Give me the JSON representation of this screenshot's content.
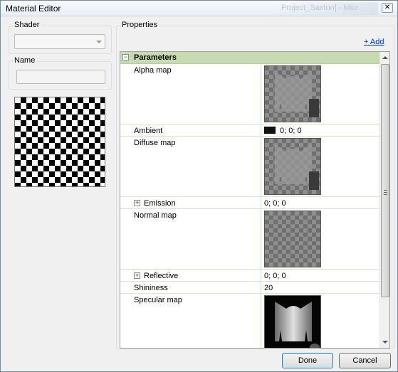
{
  "window": {
    "title": "Material Editor",
    "background_title": "Project_Saxton] - Micr"
  },
  "shader": {
    "label": "Shader",
    "value": ""
  },
  "name": {
    "label": "Name",
    "value": ""
  },
  "properties": {
    "label": "Properties",
    "add_link": "+ Add",
    "category": "Parameters",
    "rows": {
      "alpha_map": {
        "name": "Alpha map"
      },
      "ambient": {
        "name": "Ambient",
        "value": "0; 0; 0",
        "color": "#111111"
      },
      "diffuse_map": {
        "name": "Diffuse map"
      },
      "emission": {
        "name": "Emission",
        "value": "0; 0; 0"
      },
      "normal_map": {
        "name": "Normal map"
      },
      "reflective": {
        "name": "Reflective",
        "value": "0; 0; 0"
      },
      "shininess": {
        "name": "Shininess",
        "value": "20"
      },
      "specular_map": {
        "name": "Specular map"
      }
    }
  },
  "buttons": {
    "done": "Done",
    "cancel": "Cancel"
  },
  "icons": {
    "expand": "+",
    "collapse": "−",
    "close": "✕"
  },
  "colors": {
    "category_bg": "#c8dbb0",
    "link": "#0033cc",
    "window_bg": "#f0f0f0"
  }
}
